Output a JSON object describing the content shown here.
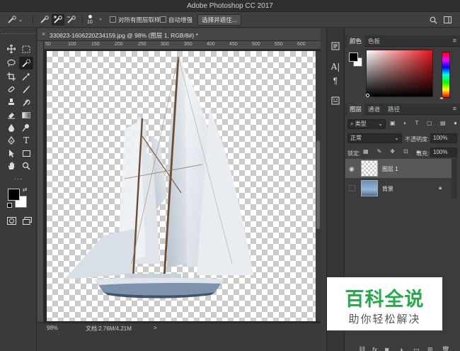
{
  "window": {
    "title": "Adobe Photoshop CC 2017"
  },
  "options_bar": {
    "brush_size": "10",
    "sample_all_layers_label": "对所有图层取样",
    "auto_enhance_label": "自动增强",
    "select_and_mask_label": "选择并遮住..."
  },
  "document": {
    "tab_label": "330823-1606220Z34159.jpg @ 98% (图层 1, RGB/8#) *",
    "close_glyph": "×"
  },
  "ruler": {
    "top_labels": [
      "50",
      "100",
      "150",
      "200",
      "250",
      "300",
      "350",
      "400",
      "450",
      "500",
      "550",
      "600"
    ]
  },
  "status": {
    "zoom": "98%",
    "doc_info": "文档:2.76M/4.21M",
    "arrow": ">"
  },
  "color_panel": {
    "tabs": [
      "颜色",
      "色板"
    ],
    "foreground": "#000000",
    "background": "#ffffff"
  },
  "layers_panel": {
    "tabs": [
      "图层",
      "通道",
      "路径"
    ],
    "filter_label": "类型",
    "blend_mode": "正常",
    "opacity_label": "不透明度:",
    "opacity_value": "100%",
    "lock_label": "锁定:",
    "fill_label": "填充:",
    "fill_value": "100%",
    "layers": [
      {
        "name": "图层 1",
        "visible": true,
        "selected": true
      },
      {
        "name": "背景",
        "visible": false,
        "selected": false,
        "locked": true
      }
    ],
    "bottom_icons": [
      "link-icon",
      "fx-icon",
      "mask-icon",
      "adjustment-icon",
      "folder-icon",
      "new-layer-icon",
      "trash-icon"
    ]
  },
  "watermark": {
    "main": "百科全说",
    "sub": "助你轻松解决"
  }
}
